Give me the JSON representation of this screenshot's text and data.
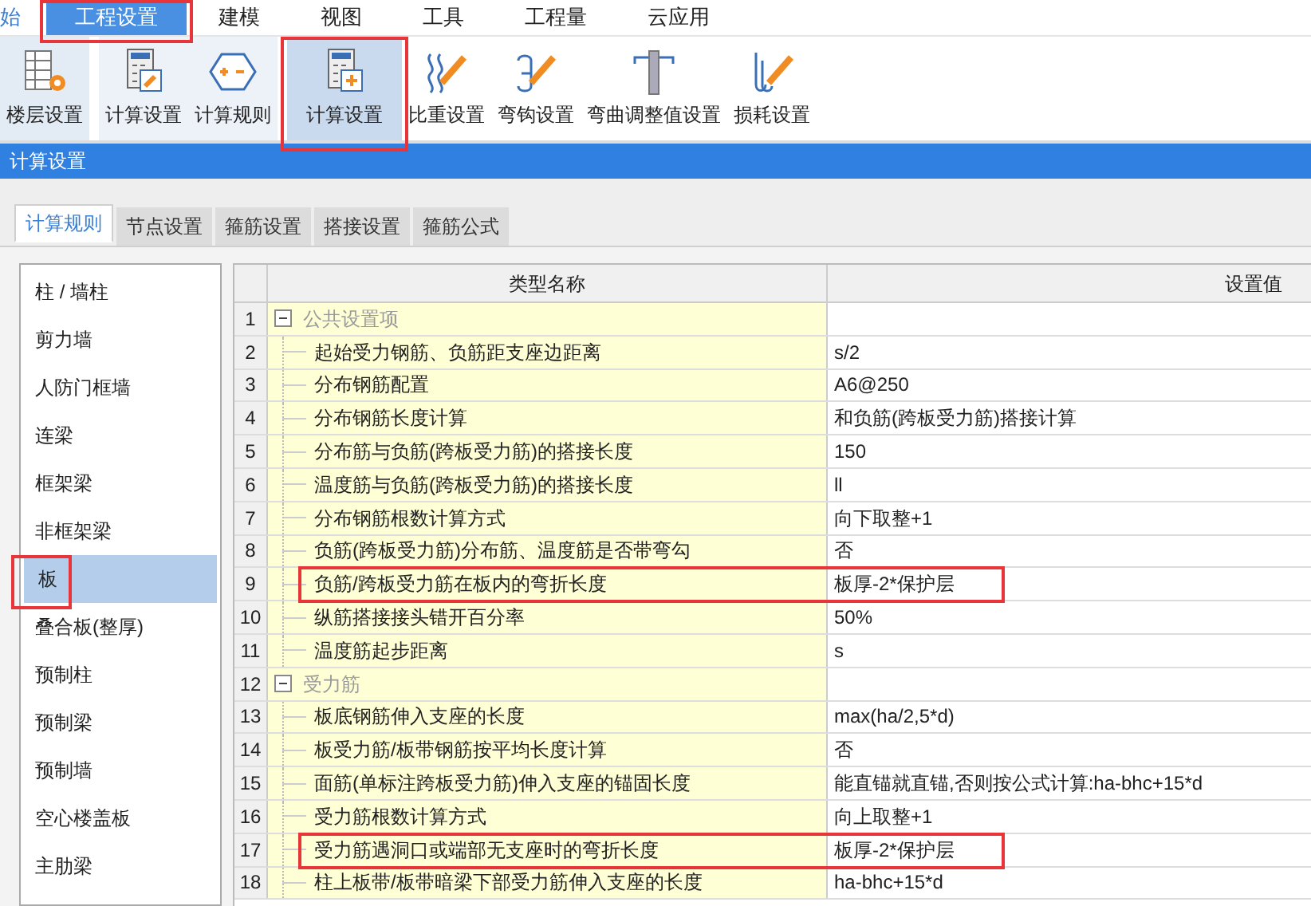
{
  "menu": [
    {
      "label": "始",
      "selected": false,
      "marked": false
    },
    {
      "label": "工程设置",
      "selected": true,
      "marked": true
    },
    {
      "label": "建模",
      "selected": false,
      "marked": false
    },
    {
      "label": "视图",
      "selected": false,
      "marked": false
    },
    {
      "label": "工具",
      "selected": false,
      "marked": false
    },
    {
      "label": "工程量",
      "selected": false,
      "marked": false
    },
    {
      "label": "云应用",
      "selected": false,
      "marked": false
    }
  ],
  "ribbon": [
    {
      "label": "楼层设置",
      "kind": "floors",
      "selected": false,
      "marked": false
    },
    {
      "label": "计算设置",
      "kind": "calc-tool",
      "selected": false,
      "marked": false
    },
    {
      "label": "计算规则",
      "kind": "rule",
      "selected": false,
      "marked": false
    },
    {
      "label": "计算设置",
      "kind": "calc-plus",
      "selected": true,
      "marked": true
    },
    {
      "label": "比重设置",
      "kind": "spring",
      "selected": false,
      "marked": false
    },
    {
      "label": "弯钩设置",
      "kind": "hook",
      "selected": false,
      "marked": false
    },
    {
      "label": "弯曲调整值设置",
      "kind": "column",
      "selected": false,
      "marked": false
    },
    {
      "label": "损耗设置",
      "kind": "loss",
      "selected": false,
      "marked": false
    }
  ],
  "panel_title": "计算设置",
  "tabs": [
    {
      "label": "计算规则",
      "selected": true
    },
    {
      "label": "节点设置",
      "selected": false
    },
    {
      "label": "箍筋设置",
      "selected": false
    },
    {
      "label": "搭接设置",
      "selected": false
    },
    {
      "label": "箍筋公式",
      "selected": false
    }
  ],
  "sidebar": [
    {
      "label": "柱 / 墙柱",
      "selected": false,
      "marked": false
    },
    {
      "label": "剪力墙",
      "selected": false,
      "marked": false
    },
    {
      "label": "人防门框墙",
      "selected": false,
      "marked": false
    },
    {
      "label": "连梁",
      "selected": false,
      "marked": false
    },
    {
      "label": "框架梁",
      "selected": false,
      "marked": false
    },
    {
      "label": "非框架梁",
      "selected": false,
      "marked": false
    },
    {
      "label": "板",
      "selected": true,
      "marked": true
    },
    {
      "label": "叠合板(整厚)",
      "selected": false,
      "marked": false
    },
    {
      "label": "预制柱",
      "selected": false,
      "marked": false
    },
    {
      "label": "预制梁",
      "selected": false,
      "marked": false
    },
    {
      "label": "预制墙",
      "selected": false,
      "marked": false
    },
    {
      "label": "空心楼盖板",
      "selected": false,
      "marked": false
    },
    {
      "label": "主肋梁",
      "selected": false,
      "marked": false
    }
  ],
  "table": {
    "columns": [
      "类型名称",
      "设置值"
    ],
    "rows": [
      {
        "num": "1",
        "kind": "group",
        "name": "公共设置项",
        "expanded": true,
        "marked": false
      },
      {
        "num": "2",
        "kind": "item",
        "name": "起始受力钢筋、负筋距支座边距离",
        "value": "s/2",
        "marked": false
      },
      {
        "num": "3",
        "kind": "item",
        "name": "分布钢筋配置",
        "value": "A6@250",
        "marked": false
      },
      {
        "num": "4",
        "kind": "item",
        "name": "分布钢筋长度计算",
        "value": "和负筋(跨板受力筋)搭接计算",
        "marked": false
      },
      {
        "num": "5",
        "kind": "item",
        "name": "分布筋与负筋(跨板受力筋)的搭接长度",
        "value": "150",
        "marked": false
      },
      {
        "num": "6",
        "kind": "item",
        "name": "温度筋与负筋(跨板受力筋)的搭接长度",
        "value": "ll",
        "marked": false
      },
      {
        "num": "7",
        "kind": "item",
        "name": "分布钢筋根数计算方式",
        "value": "向下取整+1",
        "marked": false
      },
      {
        "num": "8",
        "kind": "item",
        "name": "负筋(跨板受力筋)分布筋、温度筋是否带弯勾",
        "value": "否",
        "marked": false
      },
      {
        "num": "9",
        "kind": "item",
        "name": "负筋/跨板受力筋在板内的弯折长度",
        "value": "板厚-2*保护层",
        "marked": true
      },
      {
        "num": "10",
        "kind": "item",
        "name": "纵筋搭接接头错开百分率",
        "value": "50%",
        "marked": false
      },
      {
        "num": "11",
        "kind": "item",
        "name": "温度筋起步距离",
        "value": "s",
        "marked": false
      },
      {
        "num": "12",
        "kind": "group",
        "name": "受力筋",
        "expanded": true,
        "marked": false
      },
      {
        "num": "13",
        "kind": "item",
        "name": "板底钢筋伸入支座的长度",
        "value": "max(ha/2,5*d)",
        "marked": false
      },
      {
        "num": "14",
        "kind": "item",
        "name": "板受力筋/板带钢筋按平均长度计算",
        "value": "否",
        "marked": false
      },
      {
        "num": "15",
        "kind": "item",
        "name": "面筋(单标注跨板受力筋)伸入支座的锚固长度",
        "value": "能直锚就直锚,否则按公式计算:ha-bhc+15*d",
        "marked": false
      },
      {
        "num": "16",
        "kind": "item",
        "name": "受力筋根数计算方式",
        "value": "向上取整+1",
        "marked": false
      },
      {
        "num": "17",
        "kind": "item",
        "name": "受力筋遇洞口或端部无支座时的弯折长度",
        "value": "板厚-2*保护层",
        "marked": true
      },
      {
        "num": "18",
        "kind": "item",
        "name": "柱上板带/板带暗梁下部受力筋伸入支座的长度",
        "value": "ha-bhc+15*d",
        "marked": false
      }
    ]
  }
}
